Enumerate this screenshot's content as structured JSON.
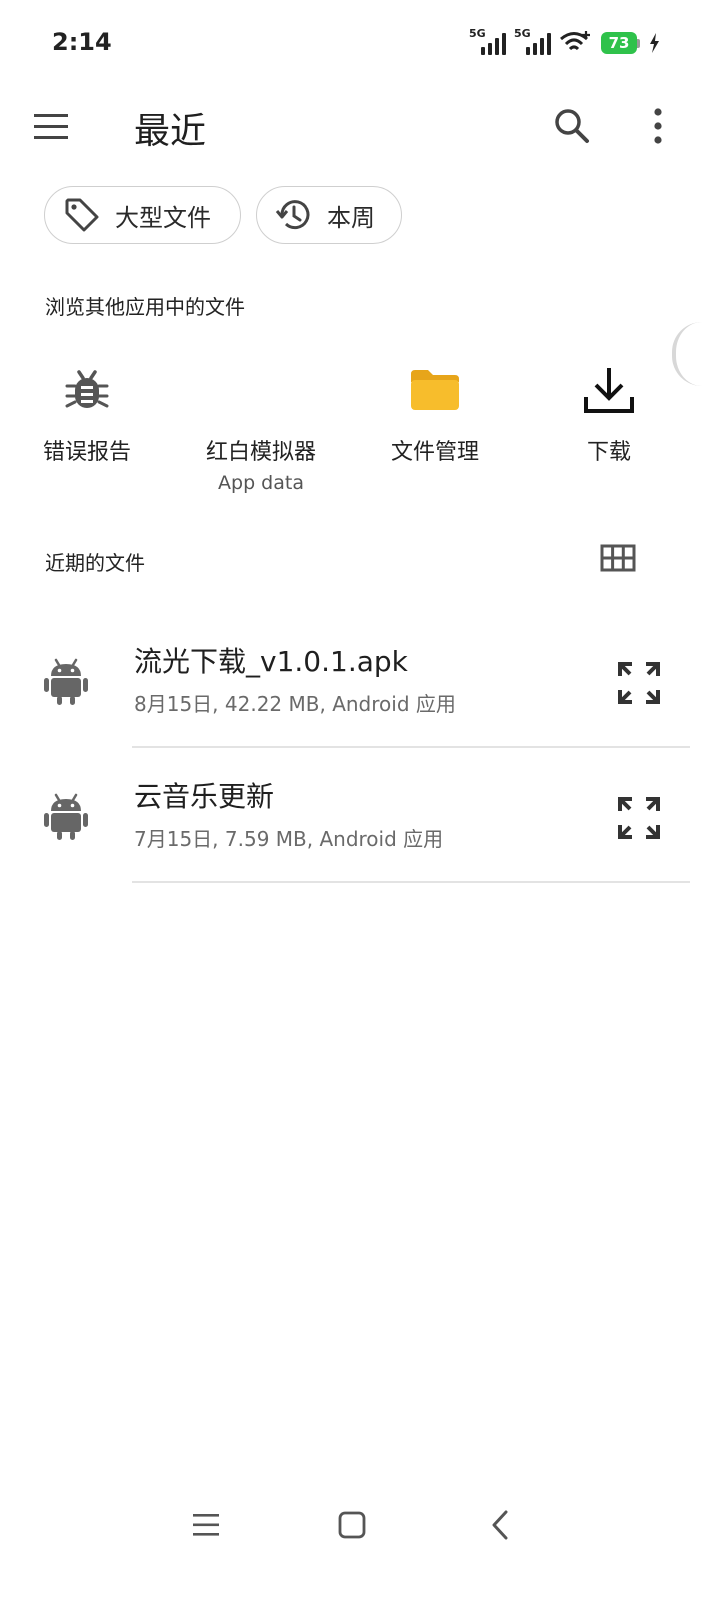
{
  "status_bar": {
    "time": "2:14",
    "network_1": "5G",
    "network_2": "5G",
    "battery": "73",
    "battery_color": "#2fc24b"
  },
  "app_bar": {
    "title": "最近",
    "icons": [
      "menu-icon",
      "search-icon",
      "more-vert-icon"
    ]
  },
  "chips": [
    {
      "label": "大型文件",
      "icon": "tag-icon"
    },
    {
      "label": "本周",
      "icon": "history-icon"
    }
  ],
  "browse_section": {
    "label": "浏览其他应用中的文件",
    "apps": [
      {
        "name": "错误报告",
        "sub": "",
        "icon": "bug-icon"
      },
      {
        "name": "红白模拟器",
        "sub": "App data",
        "icon": ""
      },
      {
        "name": "文件管理",
        "sub": "",
        "icon": "folder-icon",
        "color": "#f5b51f"
      },
      {
        "name": "下载",
        "sub": "",
        "icon": "download-icon"
      }
    ]
  },
  "recent_section": {
    "label": "近期的文件",
    "view_toggle_icon": "grid-view-icon",
    "files": [
      {
        "name": "流光下载_v1.0.1.apk",
        "meta": "8月15日, 42.22 MB, Android 应用",
        "icon": "android-icon"
      },
      {
        "name": "云音乐更新",
        "meta": "7月15日, 7.59 MB, Android 应用",
        "icon": "android-icon"
      }
    ]
  },
  "nav_bar": {
    "buttons": [
      "recents-menu-icon",
      "home-icon",
      "back-icon"
    ]
  }
}
